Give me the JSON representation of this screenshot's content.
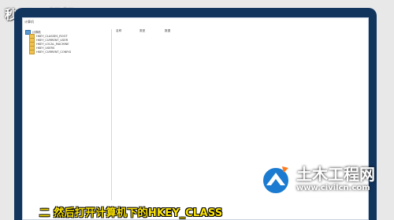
{
  "overlay": {
    "logo": "秒dǐng视频",
    "caption": "二 然后打开计算机下的HKEY_CLASS",
    "watermark_title": "土木工程网",
    "watermark_url": "www.civilcn.com"
  },
  "regedit": {
    "address": "计算机",
    "tree_root": "计算机",
    "tree_items": [
      "HKEY_CLASSES_ROOT",
      "HKEY_CURRENT_USER",
      "HKEY_LOCAL_MACHINE",
      "HKEY_USERS",
      "HKEY_CURRENT_CONFIG"
    ],
    "columns": [
      "名称",
      "类型",
      "数据"
    ]
  },
  "colors": {
    "bezel": "#12355e",
    "caption_text": "#ffe600",
    "folder": "#f0c24f"
  }
}
